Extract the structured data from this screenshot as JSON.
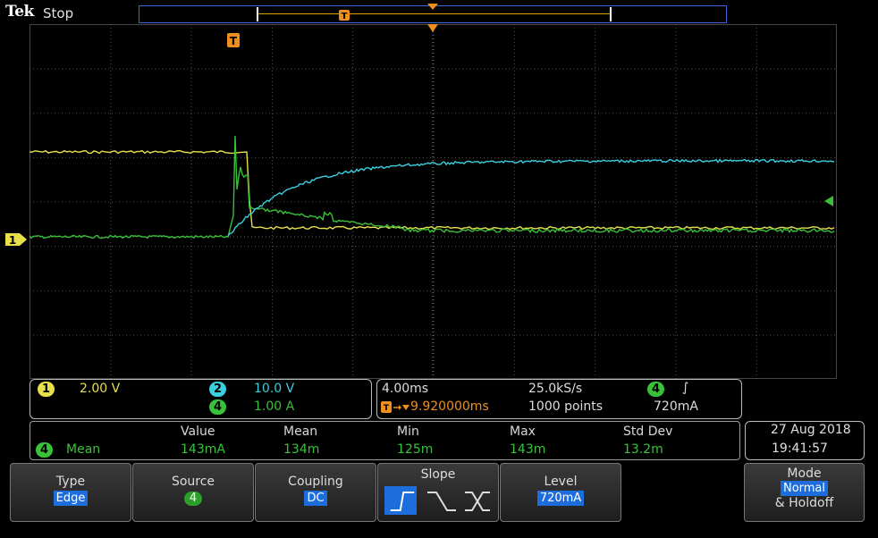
{
  "header": {
    "brand": "Tek",
    "status": "Stop"
  },
  "trigger_marker": "T",
  "channel_markers": {
    "ch1": "1"
  },
  "readouts": {
    "ch1": {
      "badge": "1",
      "scale": "2.00 V"
    },
    "ch2": {
      "badge": "2",
      "scale": "10.0 V"
    },
    "ch4": {
      "badge": "4",
      "scale": "1.00 A"
    },
    "horizontal": {
      "scale": "4.00ms",
      "sample_rate": "25.0kS/s",
      "trig_pos": "9.920000ms",
      "points": "1000 points"
    },
    "trigger": {
      "badge": "4",
      "slope": "∫",
      "level": "720mA"
    }
  },
  "measurements": {
    "source_badge": "4",
    "label": "Mean",
    "headers": [
      "Value",
      "Mean",
      "Min",
      "Max",
      "Std Dev"
    ],
    "values": [
      "143mA",
      "134m",
      "125m",
      "143m",
      "13.2m"
    ]
  },
  "datetime": {
    "date": "27 Aug 2018",
    "time": "19:41:57"
  },
  "menu": {
    "type": {
      "label": "Type",
      "value": "Edge"
    },
    "source": {
      "label": "Source",
      "value": "4"
    },
    "coupling": {
      "label": "Coupling",
      "value": "DC"
    },
    "slope": {
      "label": "Slope"
    },
    "level": {
      "label": "Level",
      "value": "720mA"
    },
    "mode": {
      "label": "Mode",
      "value": "Normal",
      "extra": "& Holdoff"
    }
  },
  "colors": {
    "ch1": "#e8e04a",
    "ch2": "#3ad0e0",
    "ch4": "#39c13a",
    "trigger": "#f0901c",
    "menu_highlight": "#1d6ddc"
  }
}
